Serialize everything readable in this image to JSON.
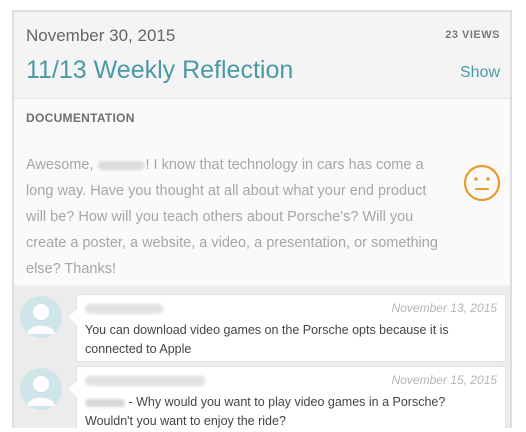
{
  "post": {
    "date": "November 30, 2015",
    "views": "23 VIEWS",
    "title": "11/13 Weekly Reflection",
    "show_label": "Show"
  },
  "documentation": {
    "label": "DOCUMENTATION",
    "greeting": "Awesome,",
    "text": "! I know that technology in cars has come a long way.  Have you thought at all about what your end product will be?  How will you teach others about Porsche's? Will you create a poster, a website, a video, a presentation, or something else?  Thanks!",
    "reaction_icon": "neutral-face-icon",
    "reaction_color": "#e99a2c"
  },
  "comments": [
    {
      "date": "November 13, 2015",
      "text": "You can download video games on the Porsche opts because it is connected to Apple"
    },
    {
      "date": "November 15, 2015",
      "text": "- Why would you want to play video games in a Porsche? Wouldn't you want to enjoy the ride?"
    }
  ]
}
